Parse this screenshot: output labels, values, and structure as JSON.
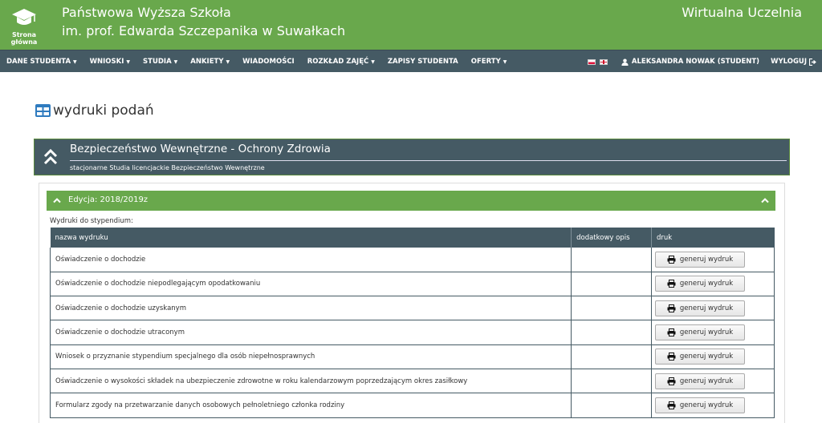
{
  "header": {
    "home_label_1": "Strona",
    "home_label_2": "główna",
    "uni_line_1": "Państwowa Wyższa Szkoła",
    "uni_line_2": "im. prof. Edwarda Szczepanika w Suwałkach",
    "portal_title": "Wirtualna Uczelnia"
  },
  "nav": {
    "items": [
      {
        "label": "DANE STUDENTA",
        "dropdown": true
      },
      {
        "label": "WNIOSKI",
        "dropdown": true
      },
      {
        "label": "STUDIA",
        "dropdown": true
      },
      {
        "label": "ANKIETY",
        "dropdown": true
      },
      {
        "label": "WIADOMOŚCI",
        "dropdown": false
      },
      {
        "label": "ROZKŁAD ZAJĘĆ",
        "dropdown": true
      },
      {
        "label": "ZAPISY STUDENTA",
        "dropdown": false
      },
      {
        "label": "OFERTY",
        "dropdown": true
      }
    ],
    "user": "ALEKSANDRA NOWAK (STUDENT)",
    "logout": "WYLOGUJ"
  },
  "page": {
    "title": "wydruki podań"
  },
  "section": {
    "title": "Bezpieczeństwo Wewnętrzne - Ochrony Zdrowia",
    "subtitle": "stacjonarne Studia licencjackie Bezpieczeństwo Wewnętrzne"
  },
  "edition": {
    "label": "Edycja: 2018/2019z"
  },
  "table": {
    "caption": "Wydruki do stypendium:",
    "headers": [
      "nazwa wydruku",
      "dodatkowy opis",
      "druk"
    ],
    "button_label": "generuj wydruk",
    "rows": [
      {
        "name": "Oświadczenie o dochodzie",
        "desc": ""
      },
      {
        "name": "Oświadczenie o dochodzie niepodlegającym opodatkowaniu",
        "desc": ""
      },
      {
        "name": "Oświadczenie o dochodzie uzyskanym",
        "desc": ""
      },
      {
        "name": "Oświadczenie o dochodzie utraconym",
        "desc": ""
      },
      {
        "name": "Wniosek o przyznanie stypendium specjalnego dla osób niepełnosprawnych",
        "desc": ""
      },
      {
        "name": "Oświadczenie o wysokości składek na ubezpieczenie zdrowotne w roku kalendarzowym poprzedzającym okres zasiłkowy",
        "desc": ""
      },
      {
        "name": "Formularz zgody na przetwarzanie danych osobowych pełnoletniego członka rodziny",
        "desc": ""
      }
    ]
  },
  "colors": {
    "brand_green": "#69a84c",
    "nav_slate": "#455a64"
  }
}
